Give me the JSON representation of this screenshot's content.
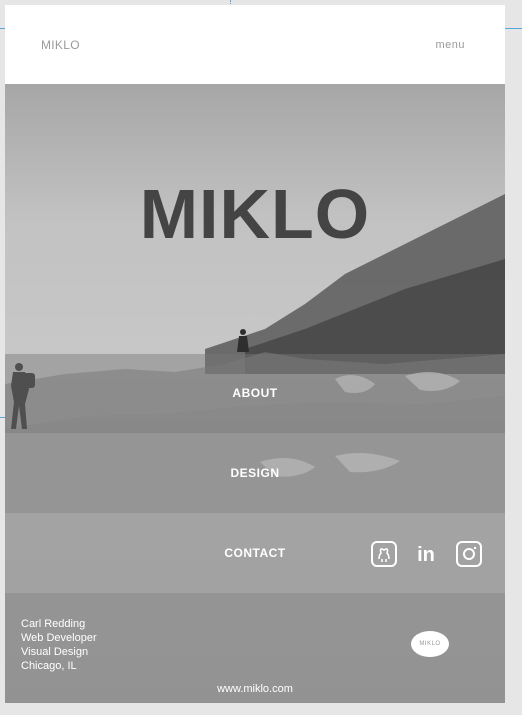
{
  "header": {
    "brand": "MIKLO",
    "menu_label": "menu"
  },
  "hero": {
    "title": "MIKLO"
  },
  "nav": {
    "about": "ABOUT",
    "design": "DESIGN",
    "contact": "CONTACT"
  },
  "social": [
    {
      "icon": "github-icon",
      "label": "GitHub"
    },
    {
      "icon": "linkedin-icon",
      "label": "in"
    },
    {
      "icon": "instagram-icon",
      "label": "Instagram"
    }
  ],
  "footer": {
    "name": "Carl Redding",
    "role1": "Web Developer",
    "role2": "Visual Design",
    "location": "Chicago, IL",
    "badge": "MIKLO",
    "url": "www.miklo.com"
  }
}
